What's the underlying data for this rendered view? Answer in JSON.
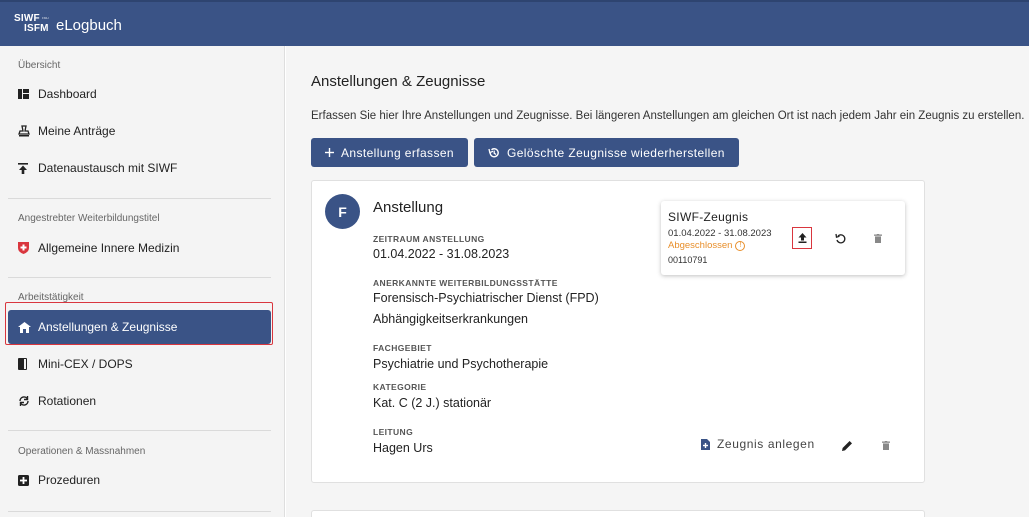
{
  "app": {
    "logo_line1": "SIWF",
    "logo_line2": "ISFM",
    "logo_small": "FMH",
    "title": "eLogbuch"
  },
  "sidebar": {
    "sections": [
      {
        "label": "Übersicht",
        "items": [
          {
            "label": "Dashboard",
            "icon": "dashboard-icon"
          },
          {
            "label": "Meine Anträge",
            "icon": "stamp-icon"
          },
          {
            "label": "Datenaustausch mit SIWF",
            "icon": "upload-icon"
          }
        ]
      },
      {
        "label": "Angestrebter Weiterbildungstitel",
        "items": [
          {
            "label": "Allgemeine Innere Medizin",
            "icon": "swiss-flag-icon"
          }
        ]
      },
      {
        "label": "Arbeitstätigkeit",
        "items": [
          {
            "label": "Anstellungen & Zeugnisse",
            "icon": "home-icon",
            "active": true
          },
          {
            "label": "Mini-CEX / DOPS",
            "icon": "book-icon"
          },
          {
            "label": "Rotationen",
            "icon": "rotate-icon"
          }
        ]
      },
      {
        "label": "Operationen & Massnahmen",
        "items": [
          {
            "label": "Prozeduren",
            "icon": "plus-box-icon"
          }
        ]
      }
    ]
  },
  "main": {
    "title": "Anstellungen & Zeugnisse",
    "intro": "Erfassen Sie hier Ihre Anstellungen und Zeugnisse. Bei längeren Anstellungen am gleichen Ort ist nach jedem Jahr ein Zeugnis zu erstellen.",
    "buttons": {
      "add": "Anstellung erfassen",
      "restore": "Gelöschte Zeugnisse wiederherstellen"
    },
    "card": {
      "avatar": "F",
      "title": "Anstellung",
      "fields": [
        {
          "label": "ZEITRAUM ANSTELLUNG",
          "values": [
            "01.04.2022 - 31.08.2023"
          ]
        },
        {
          "label": "ANERKANNTE WEITERBILDUNGSSTÄTTE",
          "values": [
            "Forensisch-Psychiatrischer Dienst (FPD)",
            "Abhängigkeitserkrankungen"
          ]
        },
        {
          "label": "FACHGEBIET",
          "values": [
            "Psychiatrie und Psychotherapie"
          ]
        },
        {
          "label": "KATEGORIE",
          "values": [
            "Kat. C (2 J.) stationär"
          ]
        },
        {
          "label": "LEITUNG",
          "values": [
            "Hagen Urs"
          ]
        }
      ],
      "certificate": {
        "title": "SIWF-Zeugnis",
        "date": "01.04.2022 - 31.08.2023",
        "status": "Abgeschlossen",
        "number": "00110791",
        "status_color": "#e88f2b"
      },
      "create_certificate": "Zeugnis anlegen"
    }
  },
  "colors": {
    "primary": "#3a5386",
    "highlight": "#d9363e"
  }
}
